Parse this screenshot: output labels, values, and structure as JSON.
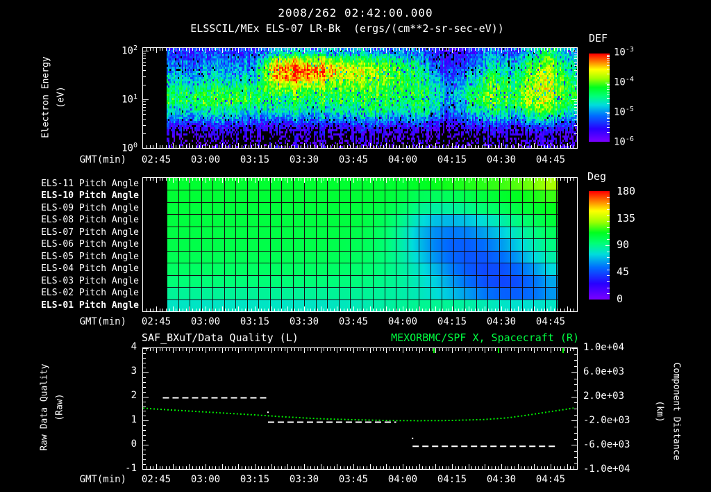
{
  "title": "2008/262 02:42:00.000",
  "subtitle": "ELSSCIL/MEx ELS-07 LR-Bk  (ergs/(cm**2-sr-sec-eV))",
  "gmt_label": "GMT(min)",
  "time_ticks": [
    "02:45",
    "03:00",
    "03:15",
    "03:30",
    "03:45",
    "04:00",
    "04:15",
    "04:30",
    "04:45"
  ],
  "spectrogram_panel": {
    "ylabel_line1": "Electron Energy",
    "ylabel_line2": "(eV)",
    "yticks": [
      {
        "base": "10",
        "exp": "2"
      },
      {
        "base": "10",
        "exp": "1"
      },
      {
        "base": "10",
        "exp": "0"
      }
    ],
    "colorbar_label": "DEF",
    "colorbar_ticks": [
      {
        "base": "10",
        "exp": "-3"
      },
      {
        "base": "10",
        "exp": "-4"
      },
      {
        "base": "10",
        "exp": "-5"
      },
      {
        "base": "10",
        "exp": "-6"
      }
    ]
  },
  "pitch_panel": {
    "row_labels": [
      {
        "text": "ELS-11 Pitch Angle",
        "bold": false
      },
      {
        "text": "ELS-10 Pitch Angle",
        "bold": true
      },
      {
        "text": "ELS-09 Pitch Angle",
        "bold": false
      },
      {
        "text": "ELS-08 Pitch Angle",
        "bold": false
      },
      {
        "text": "ELS-07 Pitch Angle",
        "bold": false
      },
      {
        "text": "ELS-06 Pitch Angle",
        "bold": false
      },
      {
        "text": "ELS-05 Pitch Angle",
        "bold": false
      },
      {
        "text": "ELS-04 Pitch Angle",
        "bold": false
      },
      {
        "text": "ELS-03 Pitch Angle",
        "bold": false
      },
      {
        "text": "ELS-02 Pitch Angle",
        "bold": false
      },
      {
        "text": "ELS-01 Pitch Angle",
        "bold": true
      }
    ],
    "colorbar_label": "Deg",
    "colorbar_ticks": [
      "180",
      "135",
      "90",
      "45",
      "0"
    ]
  },
  "quality_panel": {
    "title_left": "SAF_BXuT/Data Quality (L)",
    "title_right": "MEXORBMC/SPF X, Spacecraft (R)",
    "title_right_color": "#00ff41",
    "ylabel_left_line1": "Raw Data Quality",
    "ylabel_left_line2": "(Raw)",
    "yticks_left": [
      "4",
      "3",
      "2",
      "1",
      "0",
      "-1"
    ],
    "ylabel_right_line1": "Component Distance",
    "ylabel_right_line2": "(km)",
    "yticks_right": [
      "1.0e+04",
      "6.0e+03",
      "2.0e+03",
      "-2.0e+03",
      "-6.0e+03",
      "-1.0e+04"
    ]
  },
  "chart_data": [
    {
      "type": "heatmap",
      "name": "electron_energy_spectrogram",
      "title": "ELSSCIL/MEx ELS-07 LR-Bk",
      "units": "ergs/(cm**2-sr-sec-eV)",
      "ylabel": "Electron Energy (eV)",
      "yscale": "log",
      "ylim_ev": [
        1,
        117
      ],
      "x_start_gmt": "02:51",
      "x_step_min": 6,
      "data_start_gmt": "02:48",
      "colorbar": {
        "label": "DEF",
        "scale": "log rainbow",
        "tick_values": [
          -3,
          -4,
          -5,
          -6
        ]
      },
      "row_energies_ev": [
        95,
        63,
        41,
        27,
        17,
        11,
        7.4,
        4.8,
        3.1,
        2.0,
        1.3,
        1.0
      ],
      "log10_def": [
        [
          -5.6,
          -5.6,
          -5.6,
          -5.6,
          -5.5,
          -5.0,
          -4.9,
          -5.0,
          -5.0,
          -5.1,
          -5.2,
          -5.3,
          -5.3,
          -5.6,
          -5.9,
          -5.7,
          -5.3,
          -5.5,
          -5.0,
          -4.6,
          -5.2
        ],
        [
          -5.4,
          -5.4,
          -5.4,
          -5.4,
          -5.3,
          -3.9,
          -3.8,
          -3.9,
          -4.0,
          -4.3,
          -4.4,
          -4.6,
          -4.8,
          -5.4,
          -5.8,
          -5.5,
          -5.0,
          -5.2,
          -4.6,
          -4.2,
          -5.0
        ],
        [
          -5.2,
          -5.2,
          -5.2,
          -5.2,
          -5.1,
          -3.4,
          -3.2,
          -3.3,
          -3.5,
          -3.8,
          -3.9,
          -4.2,
          -4.5,
          -5.2,
          -5.7,
          -5.3,
          -4.7,
          -5.0,
          -4.3,
          -4.0,
          -4.8
        ],
        [
          -5.0,
          -5.0,
          -5.0,
          -5.0,
          -4.9,
          -3.5,
          -3.3,
          -3.4,
          -3.6,
          -3.8,
          -4.0,
          -4.2,
          -4.4,
          -5.0,
          -5.5,
          -5.0,
          -4.4,
          -4.7,
          -4.1,
          -3.9,
          -4.6
        ],
        [
          -4.6,
          -4.6,
          -4.6,
          -4.6,
          -4.6,
          -3.9,
          -3.8,
          -3.9,
          -4.0,
          -4.1,
          -4.2,
          -4.3,
          -4.4,
          -4.8,
          -5.3,
          -4.7,
          -4.2,
          -4.5,
          -4.0,
          -3.9,
          -4.5
        ],
        [
          -4.4,
          -4.4,
          -4.4,
          -4.4,
          -4.5,
          -4.3,
          -4.3,
          -4.3,
          -4.3,
          -4.3,
          -4.3,
          -4.4,
          -4.4,
          -4.6,
          -5.2,
          -4.5,
          -4.1,
          -4.4,
          -3.9,
          -3.9,
          -4.4
        ],
        [
          -4.4,
          -4.3,
          -4.3,
          -4.3,
          -4.4,
          -4.5,
          -4.5,
          -4.5,
          -4.4,
          -4.4,
          -4.4,
          -4.5,
          -4.5,
          -4.6,
          -5.2,
          -4.5,
          -4.2,
          -4.4,
          -4.0,
          -4.0,
          -4.5
        ],
        [
          -4.8,
          -4.7,
          -4.7,
          -4.8,
          -4.8,
          -4.8,
          -4.8,
          -4.8,
          -4.7,
          -4.6,
          -4.6,
          -4.7,
          -4.7,
          -4.8,
          -5.4,
          -4.8,
          -4.5,
          -4.7,
          -4.3,
          -4.3,
          -4.8
        ],
        [
          -5.2,
          -5.2,
          -5.2,
          -5.2,
          -5.2,
          -5.3,
          -5.3,
          -5.3,
          -5.2,
          -5.1,
          -5.1,
          -5.2,
          -5.2,
          -5.3,
          -5.7,
          -5.3,
          -5.1,
          -5.2,
          -4.9,
          -4.9,
          -5.3
        ],
        [
          -5.9,
          -5.9,
          -5.9,
          -5.9,
          -5.9,
          -6.0,
          -6.0,
          -6.0,
          -5.9,
          -5.8,
          -5.8,
          -5.9,
          -5.9,
          -5.9,
          -6.1,
          -5.9,
          -5.8,
          -5.9,
          -5.7,
          -5.7,
          -5.9
        ],
        [
          -6.2,
          -6.2,
          -6.2,
          -6.2,
          -6.2,
          -6.2,
          -6.2,
          -6.2,
          -6.2,
          -6.2,
          -6.2,
          -6.2,
          -6.2,
          -6.2,
          -6.2,
          -6.2,
          -6.2,
          -6.2,
          -6.2,
          -6.2,
          -6.2
        ],
        [
          -6.3,
          -6.3,
          -6.3,
          -6.3,
          -6.3,
          -6.3,
          -6.3,
          -6.3,
          -6.3,
          -6.3,
          -6.3,
          -6.3,
          -6.3,
          -6.3,
          -6.3,
          -6.3,
          -6.3,
          -6.3,
          -6.3,
          -6.3,
          -6.3
        ]
      ]
    },
    {
      "type": "heatmap",
      "name": "pitch_angle_panels",
      "rows": [
        "ELS-11",
        "ELS-10",
        "ELS-09",
        "ELS-08",
        "ELS-07",
        "ELS-06",
        "ELS-05",
        "ELS-04",
        "ELS-03",
        "ELS-02",
        "ELS-01"
      ],
      "x_start_gmt": "02:48",
      "x_step_min": 5,
      "colorbar": {
        "label": "Deg",
        "tick_values": [
          180,
          135,
          90,
          45,
          0
        ],
        "range": [
          0,
          180
        ]
      },
      "pitch_deg": [
        [
          108,
          108,
          108,
          108,
          108,
          108,
          108,
          108,
          108,
          108,
          108,
          108,
          108,
          108,
          108,
          110,
          112,
          114,
          115,
          116,
          118,
          121,
          125,
          131
        ],
        [
          107,
          107,
          107,
          107,
          107,
          107,
          107,
          107,
          107,
          107,
          107,
          107,
          107,
          106,
          104,
          100,
          99,
          100,
          102,
          105,
          108,
          111,
          114,
          118
        ],
        [
          106,
          106,
          106,
          106,
          106,
          106,
          106,
          106,
          106,
          106,
          106,
          106,
          105,
          103,
          98,
          90,
          86,
          87,
          90,
          95,
          99,
          104,
          108,
          112
        ],
        [
          105,
          105,
          105,
          105,
          105,
          105,
          105,
          105,
          105,
          105,
          105,
          105,
          103,
          99,
          90,
          78,
          70,
          68,
          71,
          77,
          84,
          92,
          99,
          106
        ],
        [
          104,
          104,
          104,
          104,
          104,
          104,
          104,
          104,
          104,
          104,
          104,
          103,
          101,
          96,
          85,
          70,
          60,
          56,
          58,
          64,
          72,
          82,
          91,
          99
        ],
        [
          103,
          103,
          103,
          103,
          103,
          103,
          103,
          103,
          103,
          103,
          102,
          101,
          99,
          94,
          84,
          70,
          58,
          51,
          50,
          54,
          62,
          72,
          83,
          92
        ],
        [
          101,
          101,
          101,
          101,
          101,
          101,
          101,
          101,
          101,
          101,
          100,
          99,
          97,
          93,
          86,
          74,
          61,
          52,
          48,
          48,
          53,
          62,
          74,
          85
        ],
        [
          98,
          98,
          98,
          98,
          98,
          98,
          98,
          98,
          98,
          98,
          97,
          96,
          95,
          92,
          87,
          79,
          68,
          57,
          49,
          45,
          46,
          52,
          62,
          75
        ],
        [
          94,
          94,
          94,
          94,
          94,
          94,
          94,
          94,
          94,
          94,
          93,
          93,
          92,
          90,
          87,
          81,
          73,
          63,
          54,
          47,
          44,
          46,
          54,
          65
        ],
        [
          88,
          88,
          88,
          88,
          88,
          88,
          88,
          88,
          88,
          88,
          88,
          88,
          88,
          87,
          85,
          82,
          77,
          70,
          63,
          56,
          51,
          50,
          54,
          62
        ],
        [
          80,
          80,
          80,
          80,
          80,
          80,
          80,
          80,
          80,
          80,
          81,
          82,
          84,
          86,
          88,
          89,
          89,
          88,
          86,
          83,
          80,
          78,
          78,
          80
        ]
      ]
    },
    {
      "type": "line",
      "name": "quality_and_spacecraft_x",
      "title_left": "SAF_BXuT/Data Quality (L)",
      "title_right": "MEXORBMC/SPF X, Spacecraft (R)",
      "xlabel": "GMT(min)",
      "ylabel_left": "Raw Data Quality (Raw)",
      "ylim_left": [
        -1,
        4
      ],
      "ylabel_right": "Component Distance (km)",
      "ylim_right": [
        -10000,
        10000
      ],
      "t_reference": "02:45",
      "series": [
        {
          "name": "SAF_BXuT/Data Quality",
          "axis": "left",
          "color": "#ffffff",
          "style": "dashed",
          "segments": [
            {
              "t_min": [
                2,
                34
              ],
              "value": 2
            },
            {
              "t_min": [
                34,
                73
              ],
              "value": 1
            },
            {
              "t_min": [
                78,
                122
              ],
              "value": 0
            }
          ],
          "dots": [
            {
              "t_min": 34,
              "value": 1.35
            },
            {
              "t_min": 78,
              "value": 0.27
            }
          ]
        },
        {
          "name": "MEXORBMC/SPF X Spacecraft",
          "axis": "right",
          "color": "#00ee00",
          "style": "dotted",
          "t_min": [
            -4,
            0,
            10,
            20,
            30,
            40,
            50,
            60,
            70,
            80,
            90,
            100,
            107,
            114,
            120,
            127
          ],
          "km": [
            80,
            -80,
            -400,
            -720,
            -1040,
            -1400,
            -1680,
            -1840,
            -1960,
            -2000,
            -1960,
            -1800,
            -1520,
            -1000,
            -480,
            80
          ]
        }
      ],
      "event_ticks_t_min": [
        84.5,
        104.2,
        123.8
      ],
      "event_tick_color": "#00ee00"
    }
  ]
}
